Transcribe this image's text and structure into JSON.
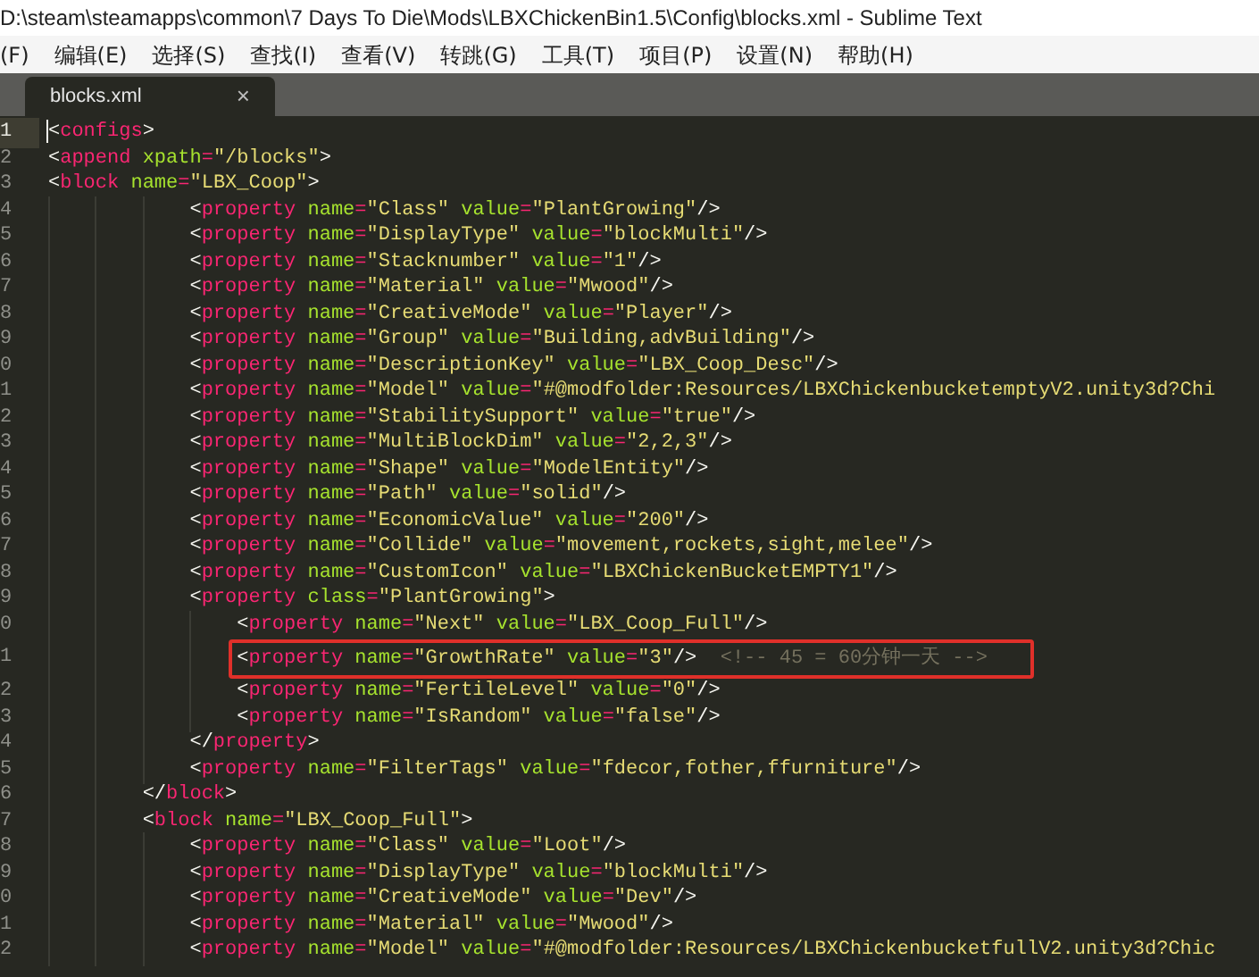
{
  "window": {
    "title": "D:\\steam\\steamapps\\common\\7 Days To Die\\Mods\\LBXChickenBin1.5\\Config\\blocks.xml - Sublime Text"
  },
  "menu": [
    "(F)",
    "编辑(E)",
    "选择(S)",
    "查找(I)",
    "查看(V)",
    "转跳(G)",
    "工具(T)",
    "项目(P)",
    "设置(N)",
    "帮助(H)"
  ],
  "tabs": [
    {
      "label": "blocks.xml",
      "close": "×",
      "selected": true
    }
  ],
  "editor": {
    "lines": [
      {
        "number": "1",
        "text": "<configs>",
        "cursor": true,
        "highlighted": false
      },
      {
        "number": "2",
        "text": "<append xpath=\"/blocks\">",
        "cursor": false,
        "highlighted": false
      },
      {
        "number": "3",
        "text": "<block name=\"LBX_Coop\">",
        "cursor": false,
        "highlighted": false
      },
      {
        "number": "4",
        "text": "            <property name=\"Class\" value=\"PlantGrowing\"/>",
        "cursor": false,
        "highlighted": false
      },
      {
        "number": "5",
        "text": "            <property name=\"DisplayType\" value=\"blockMulti\"/>",
        "cursor": false,
        "highlighted": false
      },
      {
        "number": "6",
        "text": "            <property name=\"Stacknumber\" value=\"1\"/>",
        "cursor": false,
        "highlighted": false
      },
      {
        "number": "7",
        "text": "            <property name=\"Material\" value=\"Mwood\"/>",
        "cursor": false,
        "highlighted": false
      },
      {
        "number": "8",
        "text": "            <property name=\"CreativeMode\" value=\"Player\"/>",
        "cursor": false,
        "highlighted": false
      },
      {
        "number": "9",
        "text": "            <property name=\"Group\" value=\"Building,advBuilding\"/>",
        "cursor": false,
        "highlighted": false
      },
      {
        "number": "0",
        "text": "            <property name=\"DescriptionKey\" value=\"LBX_Coop_Desc\"/>",
        "cursor": false,
        "highlighted": false
      },
      {
        "number": "1",
        "text": "            <property name=\"Model\" value=\"#@modfolder:Resources/LBXChickenbucketemptyV2.unity3d?Chi",
        "cursor": false,
        "highlighted": false
      },
      {
        "number": "2",
        "text": "            <property name=\"StabilitySupport\" value=\"true\"/>",
        "cursor": false,
        "highlighted": false
      },
      {
        "number": "3",
        "text": "            <property name=\"MultiBlockDim\" value=\"2,2,3\"/>",
        "cursor": false,
        "highlighted": false
      },
      {
        "number": "4",
        "text": "            <property name=\"Shape\" value=\"ModelEntity\"/>",
        "cursor": false,
        "highlighted": false
      },
      {
        "number": "5",
        "text": "            <property name=\"Path\" value=\"solid\"/>",
        "cursor": false,
        "highlighted": false
      },
      {
        "number": "6",
        "text": "            <property name=\"EconomicValue\" value=\"200\"/>",
        "cursor": false,
        "highlighted": false
      },
      {
        "number": "7",
        "text": "            <property name=\"Collide\" value=\"movement,rockets,sight,melee\"/>",
        "cursor": false,
        "highlighted": false
      },
      {
        "number": "8",
        "text": "            <property name=\"CustomIcon\" value=\"LBXChickenBucketEMPTY1\"/>",
        "cursor": false,
        "highlighted": false
      },
      {
        "number": "9",
        "text": "            <property class=\"PlantGrowing\">",
        "cursor": false,
        "highlighted": false
      },
      {
        "number": "0",
        "text": "                <property name=\"Next\" value=\"LBX_Coop_Full\"/>",
        "cursor": false,
        "highlighted": false
      },
      {
        "number": "1",
        "text": "                <property name=\"GrowthRate\" value=\"3\"/>  <!-- 45 = 60分钟一天 -->",
        "cursor": false,
        "highlighted": true
      },
      {
        "number": "2",
        "text": "                <property name=\"FertileLevel\" value=\"0\"/>",
        "cursor": false,
        "highlighted": false
      },
      {
        "number": "3",
        "text": "                <property name=\"IsRandom\" value=\"false\"/>",
        "cursor": false,
        "highlighted": false
      },
      {
        "number": "4",
        "text": "            </property>",
        "cursor": false,
        "highlighted": false
      },
      {
        "number": "5",
        "text": "            <property name=\"FilterTags\" value=\"fdecor,fother,ffurniture\"/>",
        "cursor": false,
        "highlighted": false
      },
      {
        "number": "6",
        "text": "        </block>",
        "cursor": false,
        "highlighted": false
      },
      {
        "number": "7",
        "text": "        <block name=\"LBX_Coop_Full\">",
        "cursor": false,
        "highlighted": false
      },
      {
        "number": "8",
        "text": "            <property name=\"Class\" value=\"Loot\"/>",
        "cursor": false,
        "highlighted": false
      },
      {
        "number": "9",
        "text": "            <property name=\"DisplayType\" value=\"blockMulti\"/>",
        "cursor": false,
        "highlighted": false
      },
      {
        "number": "0",
        "text": "            <property name=\"CreativeMode\" value=\"Dev\"/>",
        "cursor": false,
        "highlighted": false
      },
      {
        "number": "1",
        "text": "            <property name=\"Material\" value=\"Mwood\"/>",
        "cursor": false,
        "highlighted": false
      },
      {
        "number": "2",
        "text": "            <property name=\"Model\" value=\"#@modfolder:Resources/LBXChickenbucketfullV2.unity3d?Chic",
        "cursor": false,
        "highlighted": false
      }
    ]
  }
}
